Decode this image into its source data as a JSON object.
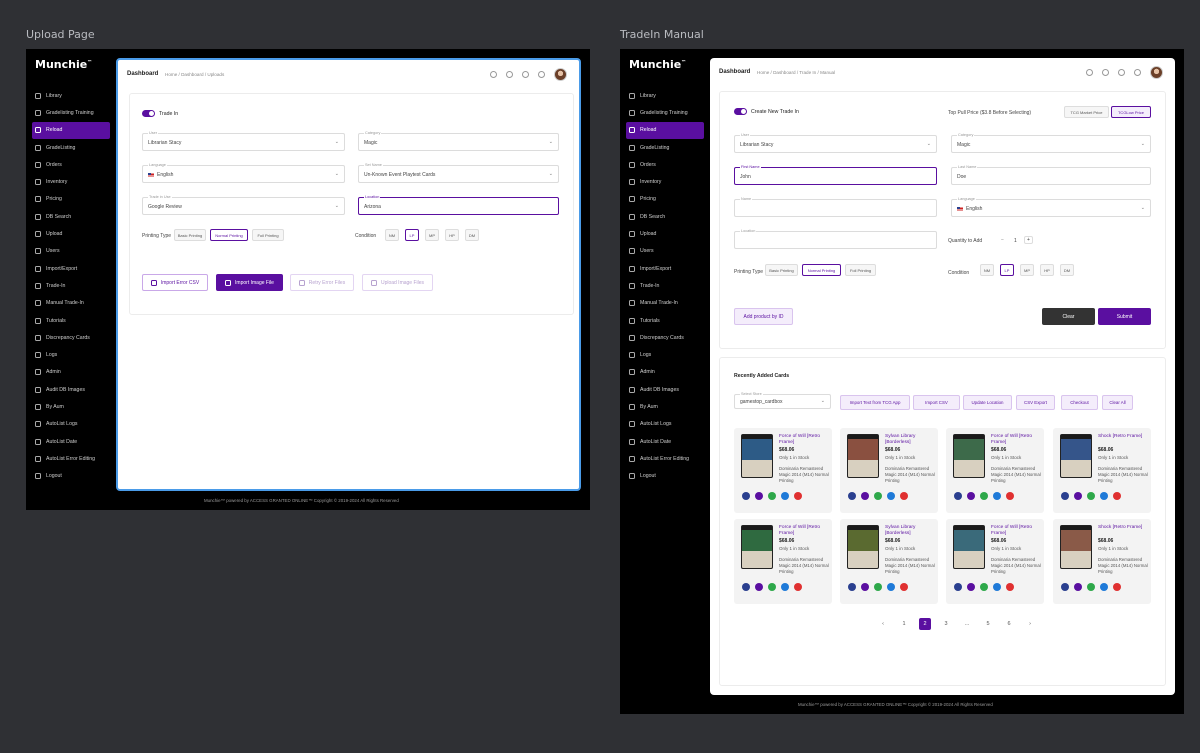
{
  "left": {
    "caption": "Upload Page",
    "logo": "Munchie",
    "logo_tm": "™",
    "title": "Dashboard",
    "breadcrumb": "Home / Dashboard / Uploads",
    "tradein_toggle": "Trade In",
    "user_label": "User",
    "user_value": "Librarian Stacy",
    "category_label": "Category",
    "category_value": "Magic",
    "language_label": "Language",
    "language_value": "English",
    "set_label": "Set Name",
    "set_value": "Un-Known Event Playtest Cards",
    "trade_label": "Trade in Use",
    "trade_value": "Google Review",
    "location_label": "Location",
    "location_value": "Arizona",
    "printing_label": "Printing Type",
    "printing": [
      "Basic Printing",
      "Normal Printing",
      "Foil Printing"
    ],
    "printing_selected": 1,
    "condition_label": "Condition",
    "conditions": [
      "NM",
      "LP",
      "MP",
      "HP",
      "DM"
    ],
    "condition_selected": 1,
    "buttons": [
      "Import Error CSV",
      "Import Image File",
      "Retry Error Files",
      "Upload Image Files"
    ],
    "footer": "Munchie™ powered by ACCESS GRANTED ONLINE™ Copyright © 2019-2024 All Rights Reserved"
  },
  "right": {
    "caption": "TradeIn Manual",
    "logo": "Munchie",
    "logo_tm": "™",
    "title": "Dashboard",
    "breadcrumb": "Home / Dashboard / Trade In / Manual",
    "tradein_toggle": "Create New Trade In",
    "price_prompt": "Top Pull Price ($3.8 Before Selecting)",
    "price_buttons": [
      "TCG Market Price",
      "TCGLow Price"
    ],
    "user_label": "User",
    "user_value": "Librarian Stacy",
    "category_label": "Category",
    "category_value": "Magic",
    "first_label": "First Name",
    "first_value": "John",
    "last_label": "Last Name",
    "last_value": "Doe",
    "name_label": "Name",
    "name_value": "",
    "language_label": "Language",
    "language_value": "English",
    "location_label": "Location",
    "location_value": "",
    "qty_label": "Quantity to Add",
    "qty_value": "1",
    "qty_minus": "−",
    "qty_plus": "+",
    "printing_label": "Printing Type",
    "printing": [
      "Basic Printing",
      "Normal Printing",
      "Foil Printing"
    ],
    "printing_selected": 1,
    "condition_label": "Condition",
    "conditions": [
      "NM",
      "LP",
      "MP",
      "HP",
      "DM"
    ],
    "condition_selected": 1,
    "add_by_id": "Add product by ID",
    "clear": "Clear",
    "submit": "Submit",
    "recent_title": "Recently Added Cards",
    "store_label": "Select Store",
    "store_value": "gamestop_cardbox",
    "action_buttons": [
      "Import Text from TCG App",
      "Import CSV",
      "Update Location",
      "CSV Export",
      "Checkout",
      "Clear All"
    ],
    "products": [
      {
        "name": "Force of Will [Retro Frame]",
        "price": "$68.06",
        "stock": "Only 1 in Stock",
        "set": "Dominaria Remastered Magic 2014 (M14) Normal Printing",
        "art": "#2d5b86"
      },
      {
        "name": "Sylvan Library [Borderless]",
        "price": "$68.06",
        "stock": "Only 1 in Stock",
        "set": "Dominaria Remastered Magic 2014 (M14) Normal Printing",
        "art": "#8a5040"
      },
      {
        "name": "Force of Will [Retro Frame]",
        "price": "$68.06",
        "stock": "Only 1 in Stock",
        "set": "Dominaria Remastered Magic 2014 (M14) Normal Printing",
        "art": "#3d6a4a"
      },
      {
        "name": "Shock [Retro Frame]",
        "price": "$68.06",
        "stock": "Only 1 in Stock",
        "set": "Dominaria Remastered Magic 2014 (M14) Normal Printing",
        "art": "#35558a"
      },
      {
        "name": "Force of Will [Retro Frame]",
        "price": "$68.06",
        "stock": "Only 1 in Stock",
        "set": "Dominaria Remastered Magic 2014 (M14) Normal Printing",
        "art": "#2f6a40"
      },
      {
        "name": "Sylvan Library [Borderless]",
        "price": "$68.06",
        "stock": "Only 1 in Stock",
        "set": "Dominaria Remastered Magic 2014 (M14) Normal Printing",
        "art": "#5a6a30"
      },
      {
        "name": "Force of Will [Retro Frame]",
        "price": "$68.06",
        "stock": "Only 1 in Stock",
        "set": "Dominaria Remastered Magic 2014 (M14) Normal Printing",
        "art": "#3a6a7a"
      },
      {
        "name": "Shock [Retro Frame]",
        "price": "$68.06",
        "stock": "Only 1 in Stock",
        "set": "Dominaria Remastered Magic 2014 (M14) Normal Printing",
        "art": "#8a5a48"
      }
    ],
    "pages": [
      "‹",
      "1",
      "2",
      "3",
      "...",
      "5",
      "6",
      "›"
    ],
    "page_current": 2,
    "footer": "Munchie™ powered by ACCESS GRANTED ONLINE™ Copyright © 2019-2024 All Rights Reserved"
  },
  "nav": [
    "Library",
    "Gradelisting Training",
    "Reload",
    "GradeListing",
    "Orders",
    "Inventory",
    "Pricing",
    "DB Search",
    "Upload",
    "Users",
    "Import/Export",
    "Trade-In",
    "Manual Trade-In",
    "Tutorials",
    "Discrepancy Cards",
    "Logs",
    "Admin",
    "Audit DB Images",
    "By Aum",
    "AutoList Logs",
    "AutoList Date",
    "AutoList Error Editing",
    "Logout"
  ],
  "nav_active": 2,
  "colors": {
    "accent": "#5a0fa0",
    "focus_border": "#4a9be8",
    "flag_icons": [
      "#2a3f8f",
      "#5a0fa0",
      "#2ea84a",
      "#1f7ad8",
      "#e03030"
    ]
  }
}
